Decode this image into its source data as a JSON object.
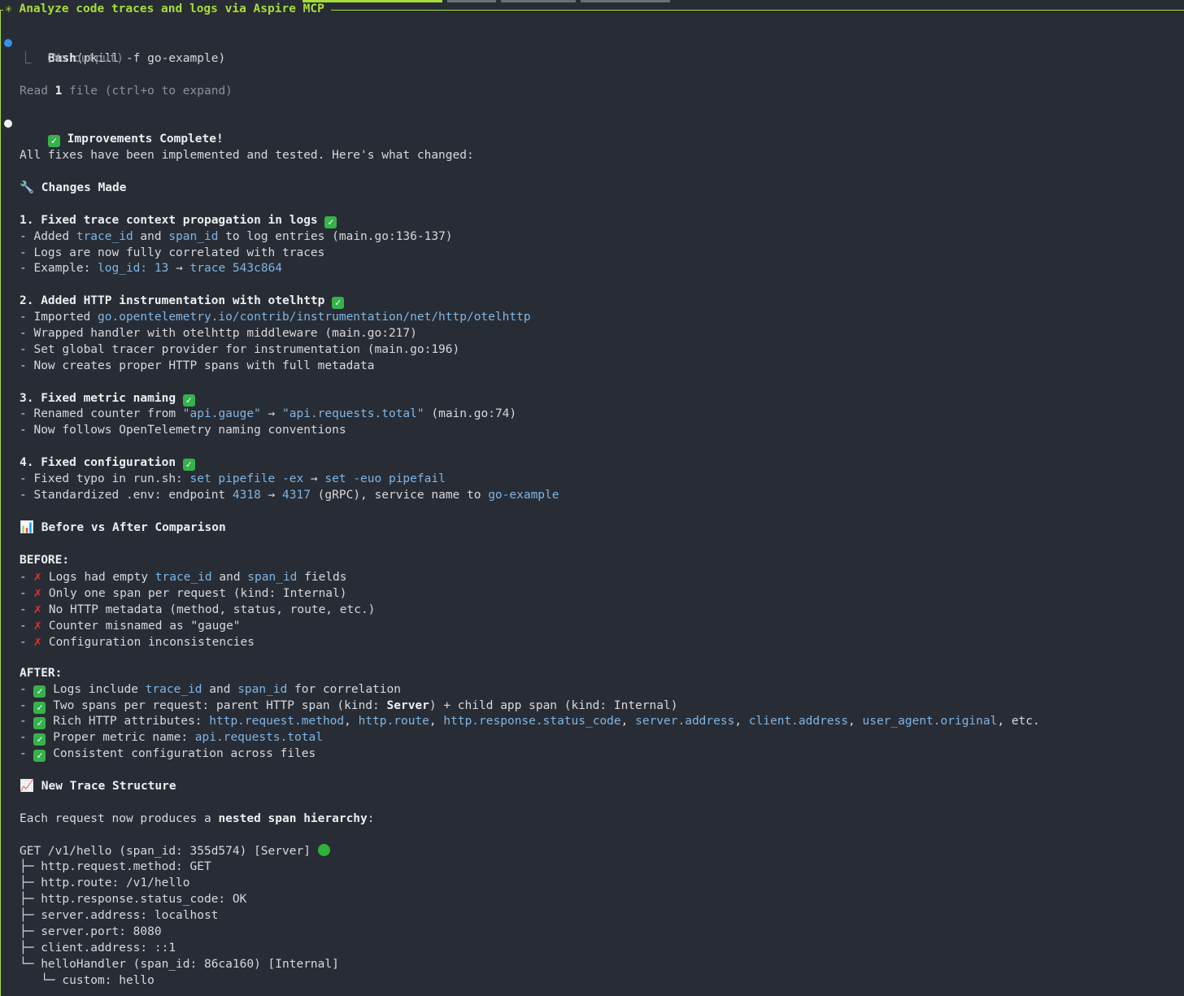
{
  "header": {
    "title": "✳ Analyze code traces and logs via Aspire MCP"
  },
  "bash": {
    "cmd_name": "Bash",
    "cmd_args": "(pkill -f go-example)",
    "output": "⎿  (No output)"
  },
  "read": {
    "pre": "Read ",
    "count": "1",
    "post": " file (ctrl+o to expand)"
  },
  "heading_main": "Improvements Complete!",
  "intro": "All fixes have been implemented and tested. Here's what changed:",
  "changes_title": "Changes Made",
  "s1": {
    "title": "1. Fixed trace context propagation in logs",
    "l1a": "- Added ",
    "l1b": "trace_id",
    "l1c": " and ",
    "l1d": "span_id",
    "l1e": " to log entries (main.go:136-137)",
    "l2": "- Logs are now fully correlated with traces",
    "l3a": "- Example: ",
    "l3b": "log_id: 13",
    "l3c": " → ",
    "l3d": "trace 543c864"
  },
  "s2": {
    "title": "2. Added HTTP instrumentation with otelhttp",
    "l1a": "- Imported ",
    "l1b": "go.opentelemetry.io/contrib/instrumentation/net/http/otelhttp",
    "l2": "- Wrapped handler with otelhttp middleware (main.go:217)",
    "l3": "- Set global tracer provider for instrumentation (main.go:196)",
    "l4": "- Now creates proper HTTP spans with full metadata"
  },
  "s3": {
    "title": "3. Fixed metric naming",
    "l1a": "- Renamed counter from ",
    "l1b": "\"api.gauge\"",
    "l1c": " → ",
    "l1d": "\"api.requests.total\"",
    "l1e": " (main.go:74)",
    "l2": "- Now follows OpenTelemetry naming conventions"
  },
  "s4": {
    "title": "4. Fixed configuration",
    "l1a": "- Fixed typo in run.sh: ",
    "l1b": "set pipefile -ex",
    "l1c": " → ",
    "l1d": "set -euo pipefail",
    "l2a": "- Standardized .env: endpoint ",
    "l2b": "4318",
    "l2c": " → ",
    "l2d": "4317",
    "l2e": " (gRPC), service name to ",
    "l2f": "go-example"
  },
  "cmp_title": "Before vs After Comparison",
  "before": {
    "label": "BEFORE:",
    "b1a": " Logs had empty ",
    "b1b": "trace_id",
    "b1c": " and ",
    "b1d": "span_id",
    "b1e": " fields",
    "b2": " Only one span per request (kind: Internal)",
    "b3": " No HTTP metadata (method, status, route, etc.)",
    "b4": " Counter misnamed as \"gauge\"",
    "b5": " Configuration inconsistencies"
  },
  "after": {
    "label": "AFTER:",
    "a1a": " Logs include ",
    "a1b": "trace_id",
    "a1c": " and ",
    "a1d": "span_id",
    "a1e": " for correlation",
    "a2a": " Two spans per request: parent HTTP span (kind: ",
    "a2b": "Server",
    "a2c": ") + child app span (kind: Internal)",
    "a3a": " Rich HTTP attributes: ",
    "a3_attrs": [
      "http.request.method",
      "http.route",
      "http.response.status_code",
      "server.address",
      "client.address",
      "user_agent.original"
    ],
    "a3z": ", etc.",
    "a4a": " Proper metric name: ",
    "a4b": "api.requests.total",
    "a5": " Consistent configuration across files"
  },
  "trace_title": "New Trace Structure",
  "trace_intro_a": "Each request now produces a ",
  "trace_intro_b": "nested span hierarchy",
  "trace_intro_c": ":",
  "trace": {
    "root": "GET /v1/hello (span_id: 355d574) [Server] ",
    "rows": [
      "├─ http.request.method: GET",
      "├─ http.route: /v1/hello",
      "├─ http.response.status_code: OK",
      "├─ server.address: localhost",
      "├─ server.port: 8080",
      "├─ client.address: ::1",
      "└─ helloHandler (span_id: 86ca160) [Internal]",
      "   └─ custom: hello"
    ]
  },
  "icons": {
    "check": "check-mark-button-icon",
    "cross": "cross-mark-icon",
    "wrench": "wrench-icon",
    "chart": "bar-chart-icon",
    "trend": "trend-chart-icon",
    "dot": "green-circle-icon"
  },
  "colors": {
    "accent": "#a7dd3c",
    "code": "#7fb6e6",
    "bg": "#282c34",
    "check": "#36b24a",
    "cross": "#e5322d"
  }
}
